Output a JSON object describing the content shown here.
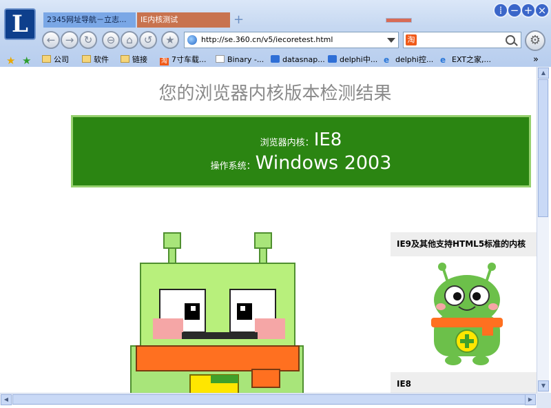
{
  "tabs": [
    {
      "label": "2345网址导航－立志..."
    },
    {
      "label": "IE内核测试"
    }
  ],
  "new_tab": "+",
  "address": {
    "url": "http://se.360.cn/v5/iecoretest.html"
  },
  "search": {
    "engine_badge": "淘"
  },
  "bookmarks": [
    {
      "label": "公司",
      "icon": "folder-icon"
    },
    {
      "label": "软件",
      "icon": "folder-icon"
    },
    {
      "label": "链接",
      "icon": "folder-icon"
    },
    {
      "label": "7寸车载...",
      "icon": "taobao-icon"
    },
    {
      "label": "Binary -...",
      "icon": "page-icon"
    },
    {
      "label": "datasnap...",
      "icon": "site-icon"
    },
    {
      "label": "delphi中...",
      "icon": "site-icon"
    },
    {
      "label": "delphi控...",
      "icon": "ie-icon"
    },
    {
      "label": "EXT之家,...",
      "icon": "ie-icon"
    }
  ],
  "page": {
    "title": "您的浏览器内核版本检测结果",
    "core_label": "浏览器内核：",
    "core_value": "IE8",
    "os_label": "操作系统：",
    "os_value": "Windows 2003",
    "side_heading_1": "IE9及其他支持HTML5标准的内核",
    "side_heading_2": "IE8"
  },
  "colors": {
    "result_bg": "#2b8512",
    "result_border": "#96d06e",
    "robot_green": "#a8e57a",
    "scarf_orange": "#ff7020"
  }
}
